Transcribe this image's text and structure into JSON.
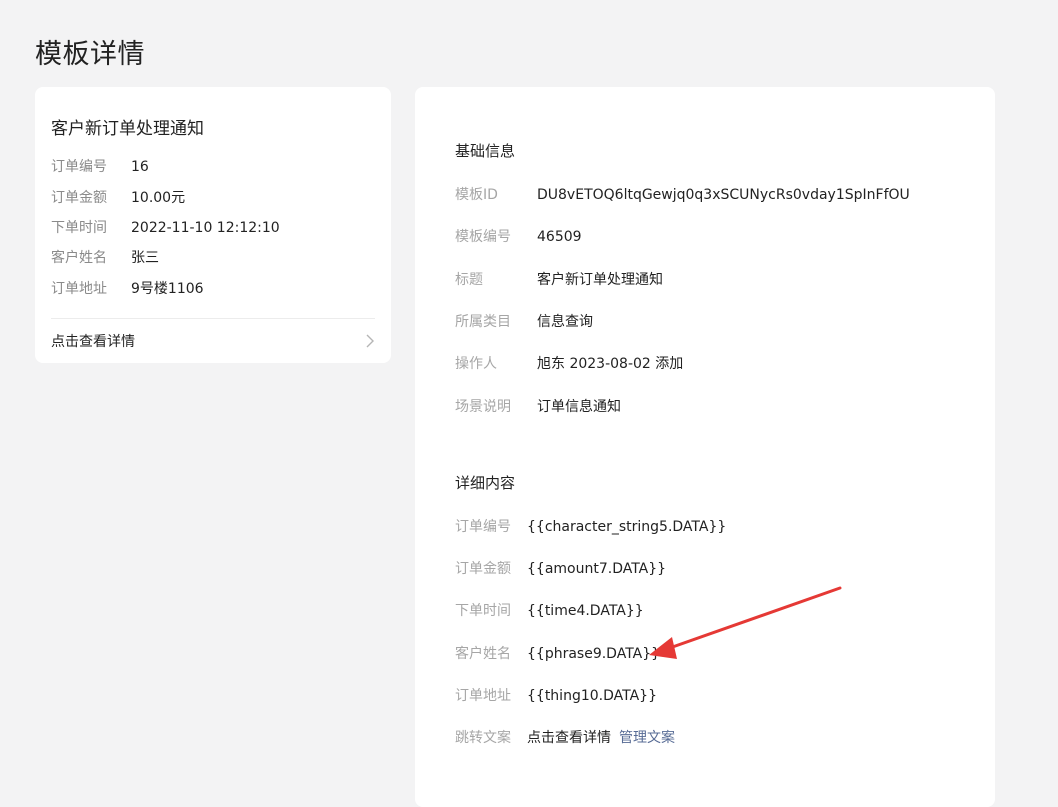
{
  "page": {
    "title": "模板详情"
  },
  "preview": {
    "title": "客户新订单处理通知",
    "rows": [
      {
        "label": "订单编号",
        "value": "16"
      },
      {
        "label": "订单金额",
        "value": "10.00元"
      },
      {
        "label": "下单时间",
        "value": "2022-11-10 12:12:10"
      },
      {
        "label": "客户姓名",
        "value": "张三"
      },
      {
        "label": "订单地址",
        "value": "9号楼1106"
      }
    ],
    "link_label": "点击查看详情"
  },
  "basic": {
    "heading": "基础信息",
    "rows": [
      {
        "label": "模板ID",
        "value": "DU8vETOQ6ltqGewjq0q3xSCUNycRs0vday1SpInFfOU"
      },
      {
        "label": "模板编号",
        "value": "46509"
      },
      {
        "label": "标题",
        "value": "客户新订单处理通知"
      },
      {
        "label": "所属类目",
        "value": "信息查询"
      },
      {
        "label": "操作人",
        "value": "旭东 2023-08-02 添加"
      },
      {
        "label": "场景说明",
        "value": "订单信息通知"
      }
    ]
  },
  "content": {
    "heading": "详细内容",
    "rows": [
      {
        "label": "订单编号",
        "value": "{{character_string5.DATA}}"
      },
      {
        "label": "订单金额",
        "value": "{{amount7.DATA}}"
      },
      {
        "label": "下单时间",
        "value": "{{time4.DATA}}"
      },
      {
        "label": "客户姓名",
        "value": "{{phrase9.DATA}}"
      },
      {
        "label": "订单地址",
        "value": "{{thing10.DATA}}"
      },
      {
        "label": "跳转文案",
        "value": "点击查看详情"
      }
    ],
    "manage_link": "管理文案"
  },
  "colors": {
    "link": "#576b95",
    "annotation_arrow": "#e53935",
    "background": "#f3f3f4"
  }
}
